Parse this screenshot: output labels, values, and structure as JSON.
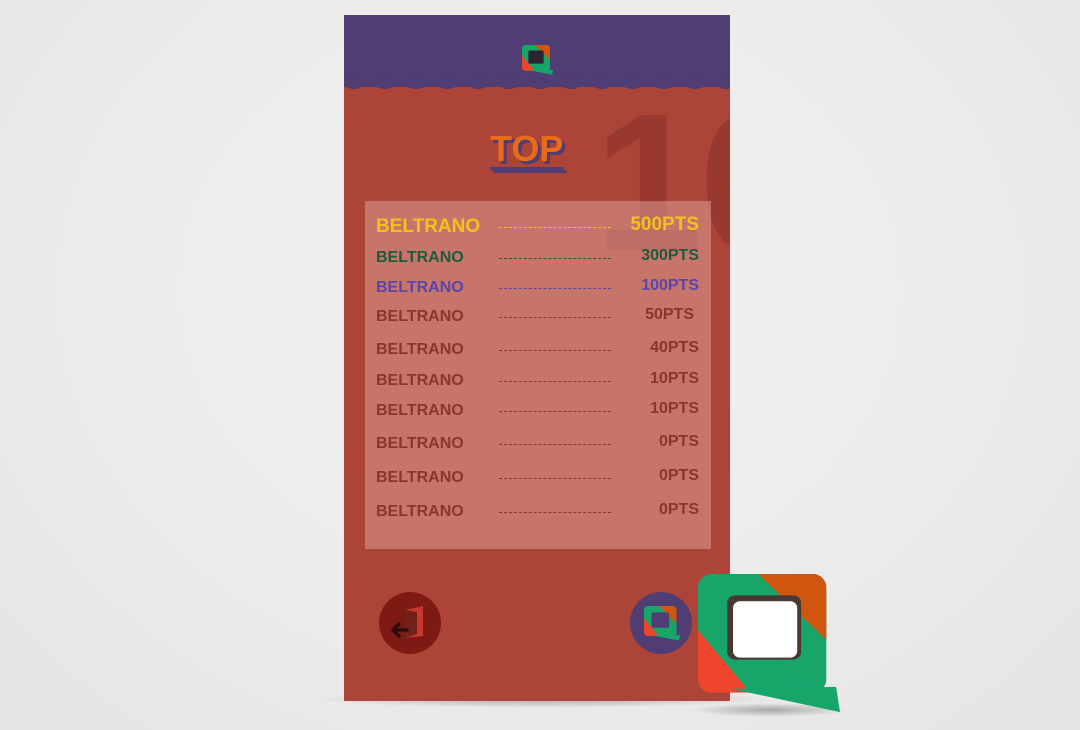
{
  "header": {
    "logo_icon": "chat-bubble-logo-icon"
  },
  "leaderboard": {
    "title": "TOP",
    "big_number": "10",
    "rows": [
      {
        "name": "BELTRANO",
        "points": "500PTS",
        "color": "#f2c21b"
      },
      {
        "name": "BELTRANO",
        "points": "300PTS",
        "color": "#1e5a3c"
      },
      {
        "name": "BELTRANO",
        "points": "100PTS",
        "color": "#5a46a8"
      },
      {
        "name": "BELTRANO",
        "points": "50PTS",
        "color": "#8a3630"
      },
      {
        "name": "BELTRANO",
        "points": "40PTS",
        "color": "#8a3630"
      },
      {
        "name": "BELTRANO",
        "points": "10PTS",
        "color": "#8a3630"
      },
      {
        "name": "BELTRANO",
        "points": "10PTS",
        "color": "#8a3630"
      },
      {
        "name": "BELTRANO",
        "points": "0PTS",
        "color": "#8a3630"
      },
      {
        "name": "BELTRANO",
        "points": "0PTS",
        "color": "#8a3630"
      },
      {
        "name": "BELTRANO",
        "points": "0PTS",
        "color": "#8a3630"
      }
    ]
  },
  "footer": {
    "exit_icon": "exit-door-icon",
    "app_icon": "chat-bubble-logo-icon"
  },
  "colors": {
    "header_purple": "#4f3d74",
    "body_red": "#ad4438",
    "title_orange": "#e86a1b",
    "logo_green": "#17a56a",
    "logo_orange": "#d0560f",
    "logo_red": "#f0442e"
  }
}
